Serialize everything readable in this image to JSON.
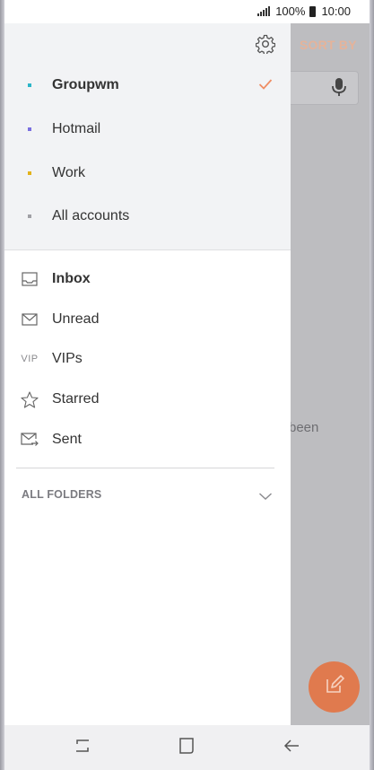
{
  "statusbar": {
    "battery_text": "100%",
    "time": "10:00"
  },
  "background": {
    "sort_label": "SORT BY",
    "partial_text": "been",
    "fab_icon": "compose-icon"
  },
  "drawer": {
    "settings_icon": "gear-icon",
    "accounts": [
      {
        "label": "Groupwm",
        "color": "#2bb5c8",
        "selected": true
      },
      {
        "label": "Hotmail",
        "color": "#7a6fe0",
        "selected": false
      },
      {
        "label": "Work",
        "color": "#e3b21a",
        "selected": false
      },
      {
        "label": "All accounts",
        "color": "#a0a0a5",
        "selected": false
      }
    ],
    "accent_color": "#ef8d63",
    "folders": [
      {
        "label": "Inbox",
        "icon": "inbox-icon",
        "bold": true
      },
      {
        "label": "Unread",
        "icon": "envelope-icon",
        "bold": false
      },
      {
        "label": "VIPs",
        "icon": "vip-icon",
        "icon_text": "VIP",
        "bold": false
      },
      {
        "label": "Starred",
        "icon": "star-icon",
        "bold": false
      },
      {
        "label": "Sent",
        "icon": "sent-icon",
        "bold": false
      }
    ],
    "all_folders_label": "ALL FOLDERS"
  },
  "navbar": {
    "buttons": [
      "recent-apps-icon",
      "home-icon",
      "back-icon"
    ]
  }
}
